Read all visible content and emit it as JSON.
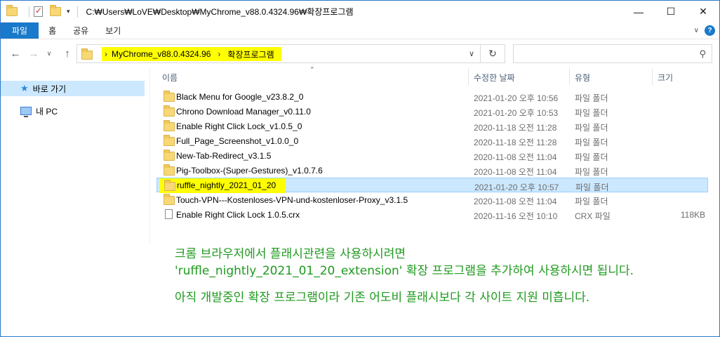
{
  "window": {
    "title": "C:₩Users₩LoVE₩Desktop₩MyChrome_v88.0.4324.96₩확장프로그램"
  },
  "ribbon": {
    "tabs": [
      "파일",
      "홈",
      "공유",
      "보기"
    ]
  },
  "address": {
    "crumb1": "MyChrome_v88.0.4324.96",
    "separator": "›",
    "crumb2": "확장프로그램"
  },
  "search": {
    "placeholder": ""
  },
  "nav": {
    "quick_access": "바로 가기",
    "this_pc": "내 PC"
  },
  "columns": {
    "name": "이름",
    "date": "수정한 날짜",
    "type": "유형",
    "size": "크기"
  },
  "files": [
    {
      "name": "Black Menu for Google_v23.8.2_0",
      "date": "2021-01-20 오후 10:56",
      "type": "파일 폴더",
      "size": "",
      "kind": "folder"
    },
    {
      "name": "Chrono Download Manager_v0.11.0",
      "date": "2021-01-20 오후 10:53",
      "type": "파일 폴더",
      "size": "",
      "kind": "folder"
    },
    {
      "name": "Enable Right Click Lock_v1.0.5_0",
      "date": "2020-11-18 오전 11:28",
      "type": "파일 폴더",
      "size": "",
      "kind": "folder"
    },
    {
      "name": "Full_Page_Screenshot_v1.0.0_0",
      "date": "2020-11-18 오전 11:28",
      "type": "파일 폴더",
      "size": "",
      "kind": "folder"
    },
    {
      "name": "New-Tab-Redirect_v3.1.5",
      "date": "2020-11-08 오전 11:04",
      "type": "파일 폴더",
      "size": "",
      "kind": "folder"
    },
    {
      "name": "Pig-Toolbox-(Super-Gestures)_v1.0.7.6",
      "date": "2020-11-08 오전 11:04",
      "type": "파일 폴더",
      "size": "",
      "kind": "folder"
    },
    {
      "name": "ruffle_nightly_2021_01_20",
      "date": "2021-01-20 오후 10:57",
      "type": "파일 폴더",
      "size": "",
      "kind": "folder",
      "selected": true
    },
    {
      "name": "Touch-VPN---Kostenloses-VPN-und-kostenloser-Proxy_v3.1.5",
      "date": "2020-11-08 오전 11:04",
      "type": "파일 폴더",
      "size": "",
      "kind": "folder"
    },
    {
      "name": "Enable Right Click Lock 1.0.5.crx",
      "date": "2020-11-16 오전 10:10",
      "type": "CRX 파일",
      "size": "118KB",
      "kind": "file"
    }
  ],
  "note": {
    "line1": "크롬 브라우저에서 플래시관련을 사용하시려면",
    "line2": "'ruffle_nightly_2021_01_20_extension' 확장 프로그램을 추가하여 사용하시면 됩니다.",
    "line3": "아직 개발중인 확장 프로그램이라 기존 어도비 플래시보다 각 사이트 지원 미흡니다."
  },
  "colors": {
    "accent": "#1979ca",
    "highlight": "#ffff00",
    "selection": "#cce8ff",
    "note_text": "#1f9a1f"
  }
}
